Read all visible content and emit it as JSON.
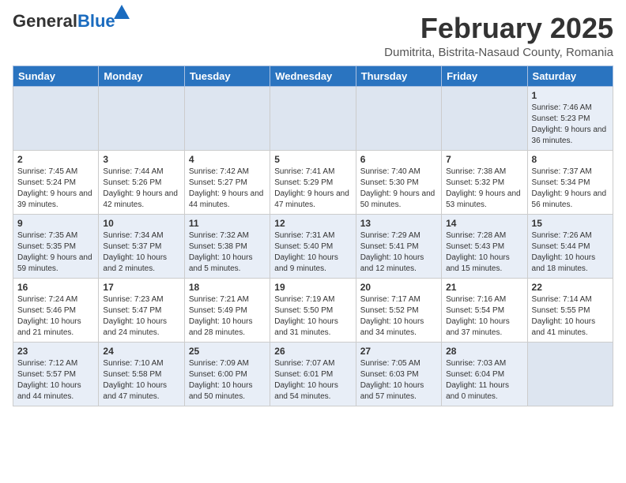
{
  "header": {
    "logo_general": "General",
    "logo_blue": "Blue",
    "month_year": "February 2025",
    "location": "Dumitrita, Bistrita-Nasaud County, Romania"
  },
  "weekdays": [
    "Sunday",
    "Monday",
    "Tuesday",
    "Wednesday",
    "Thursday",
    "Friday",
    "Saturday"
  ],
  "weeks": [
    [
      {
        "day": "",
        "info": ""
      },
      {
        "day": "",
        "info": ""
      },
      {
        "day": "",
        "info": ""
      },
      {
        "day": "",
        "info": ""
      },
      {
        "day": "",
        "info": ""
      },
      {
        "day": "",
        "info": ""
      },
      {
        "day": "1",
        "info": "Sunrise: 7:46 AM\nSunset: 5:23 PM\nDaylight: 9 hours and 36 minutes."
      }
    ],
    [
      {
        "day": "2",
        "info": "Sunrise: 7:45 AM\nSunset: 5:24 PM\nDaylight: 9 hours and 39 minutes."
      },
      {
        "day": "3",
        "info": "Sunrise: 7:44 AM\nSunset: 5:26 PM\nDaylight: 9 hours and 42 minutes."
      },
      {
        "day": "4",
        "info": "Sunrise: 7:42 AM\nSunset: 5:27 PM\nDaylight: 9 hours and 44 minutes."
      },
      {
        "day": "5",
        "info": "Sunrise: 7:41 AM\nSunset: 5:29 PM\nDaylight: 9 hours and 47 minutes."
      },
      {
        "day": "6",
        "info": "Sunrise: 7:40 AM\nSunset: 5:30 PM\nDaylight: 9 hours and 50 minutes."
      },
      {
        "day": "7",
        "info": "Sunrise: 7:38 AM\nSunset: 5:32 PM\nDaylight: 9 hours and 53 minutes."
      },
      {
        "day": "8",
        "info": "Sunrise: 7:37 AM\nSunset: 5:34 PM\nDaylight: 9 hours and 56 minutes."
      }
    ],
    [
      {
        "day": "9",
        "info": "Sunrise: 7:35 AM\nSunset: 5:35 PM\nDaylight: 9 hours and 59 minutes."
      },
      {
        "day": "10",
        "info": "Sunrise: 7:34 AM\nSunset: 5:37 PM\nDaylight: 10 hours and 2 minutes."
      },
      {
        "day": "11",
        "info": "Sunrise: 7:32 AM\nSunset: 5:38 PM\nDaylight: 10 hours and 5 minutes."
      },
      {
        "day": "12",
        "info": "Sunrise: 7:31 AM\nSunset: 5:40 PM\nDaylight: 10 hours and 9 minutes."
      },
      {
        "day": "13",
        "info": "Sunrise: 7:29 AM\nSunset: 5:41 PM\nDaylight: 10 hours and 12 minutes."
      },
      {
        "day": "14",
        "info": "Sunrise: 7:28 AM\nSunset: 5:43 PM\nDaylight: 10 hours and 15 minutes."
      },
      {
        "day": "15",
        "info": "Sunrise: 7:26 AM\nSunset: 5:44 PM\nDaylight: 10 hours and 18 minutes."
      }
    ],
    [
      {
        "day": "16",
        "info": "Sunrise: 7:24 AM\nSunset: 5:46 PM\nDaylight: 10 hours and 21 minutes."
      },
      {
        "day": "17",
        "info": "Sunrise: 7:23 AM\nSunset: 5:47 PM\nDaylight: 10 hours and 24 minutes."
      },
      {
        "day": "18",
        "info": "Sunrise: 7:21 AM\nSunset: 5:49 PM\nDaylight: 10 hours and 28 minutes."
      },
      {
        "day": "19",
        "info": "Sunrise: 7:19 AM\nSunset: 5:50 PM\nDaylight: 10 hours and 31 minutes."
      },
      {
        "day": "20",
        "info": "Sunrise: 7:17 AM\nSunset: 5:52 PM\nDaylight: 10 hours and 34 minutes."
      },
      {
        "day": "21",
        "info": "Sunrise: 7:16 AM\nSunset: 5:54 PM\nDaylight: 10 hours and 37 minutes."
      },
      {
        "day": "22",
        "info": "Sunrise: 7:14 AM\nSunset: 5:55 PM\nDaylight: 10 hours and 41 minutes."
      }
    ],
    [
      {
        "day": "23",
        "info": "Sunrise: 7:12 AM\nSunset: 5:57 PM\nDaylight: 10 hours and 44 minutes."
      },
      {
        "day": "24",
        "info": "Sunrise: 7:10 AM\nSunset: 5:58 PM\nDaylight: 10 hours and 47 minutes."
      },
      {
        "day": "25",
        "info": "Sunrise: 7:09 AM\nSunset: 6:00 PM\nDaylight: 10 hours and 50 minutes."
      },
      {
        "day": "26",
        "info": "Sunrise: 7:07 AM\nSunset: 6:01 PM\nDaylight: 10 hours and 54 minutes."
      },
      {
        "day": "27",
        "info": "Sunrise: 7:05 AM\nSunset: 6:03 PM\nDaylight: 10 hours and 57 minutes."
      },
      {
        "day": "28",
        "info": "Sunrise: 7:03 AM\nSunset: 6:04 PM\nDaylight: 11 hours and 0 minutes."
      },
      {
        "day": "",
        "info": ""
      }
    ]
  ]
}
